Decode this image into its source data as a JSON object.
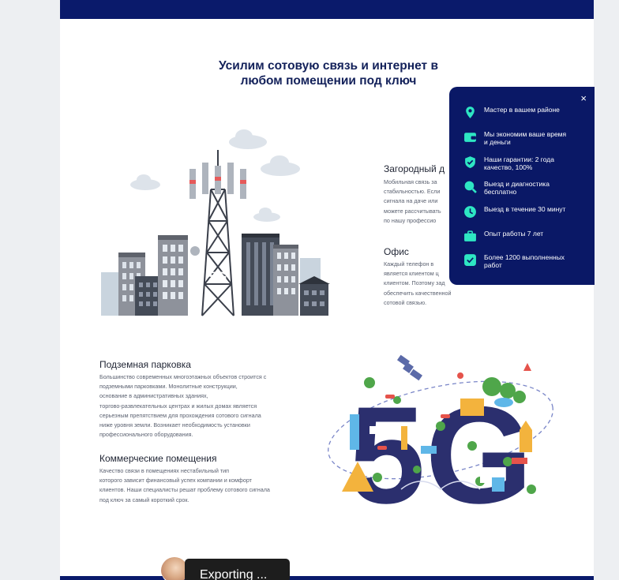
{
  "page": {
    "title_line1": "Усилим сотовую связь и интернет в",
    "title_line2": "любом помещении под ключ"
  },
  "sections": [
    {
      "heading": "Загородный д",
      "text": [
        "Мобильная связь за",
        "стабильностью. Если",
        "сигнала на даче или",
        "можете рассчитывать",
        "по нашу профессио"
      ]
    },
    {
      "heading": "Офис",
      "text": [
        "Каждый телефон в",
        "является клиентом ц",
        "клиентом. Поэтому зад",
        "обеспечить качественной",
        "сотовой связью."
      ]
    },
    {
      "heading": "Подземная парковка",
      "text": [
        "Большинство современных многоэтажных объектов строится с",
        "подземными парковками. Монолитные конструкции,",
        "основание в административных зданиях,",
        "торгово-развлекательных центрах и жилых домах является",
        "серьезным препятствием для прохождения сотового сигнала",
        "ниже уровня земли. Возникает необходимость установки",
        "профессионального оборудования."
      ]
    },
    {
      "heading": "Коммерческие помещения",
      "text": [
        "Качество связи в помещениях нестабильный тип",
        "которого зависит финансовый успех компании и комфорт",
        "клиентов. Наши специалисты решат проблему сотового сигнала",
        "под ключ за самый короткий срок."
      ]
    }
  ],
  "popup": {
    "close_label": "×",
    "items": [
      {
        "icon": "location-pin-icon",
        "text": "Мастер в вашем районе"
      },
      {
        "icon": "wallet-icon",
        "text": "Мы экономим ваше время и деньги"
      },
      {
        "icon": "shield-check-icon",
        "text": "Наши гарантии: 2 года качество, 100%"
      },
      {
        "icon": "search-icon",
        "text": "Выезд и диагностика бесплатно"
      },
      {
        "icon": "clock-icon",
        "text": "Выезд в течение 30 минут"
      },
      {
        "icon": "briefcase-icon",
        "text": "Опыт работы 7 лет"
      },
      {
        "icon": "checkbox-icon",
        "text": "Более 1200 выполненных работ"
      }
    ]
  },
  "illustrations": {
    "tower_label": "5G",
    "globe_label": "5G"
  },
  "export_badge": {
    "label": "Exporting ..."
  },
  "colors": {
    "navy": "#0a1a6b",
    "accent": "#2ee6c3",
    "title": "#13215a"
  }
}
